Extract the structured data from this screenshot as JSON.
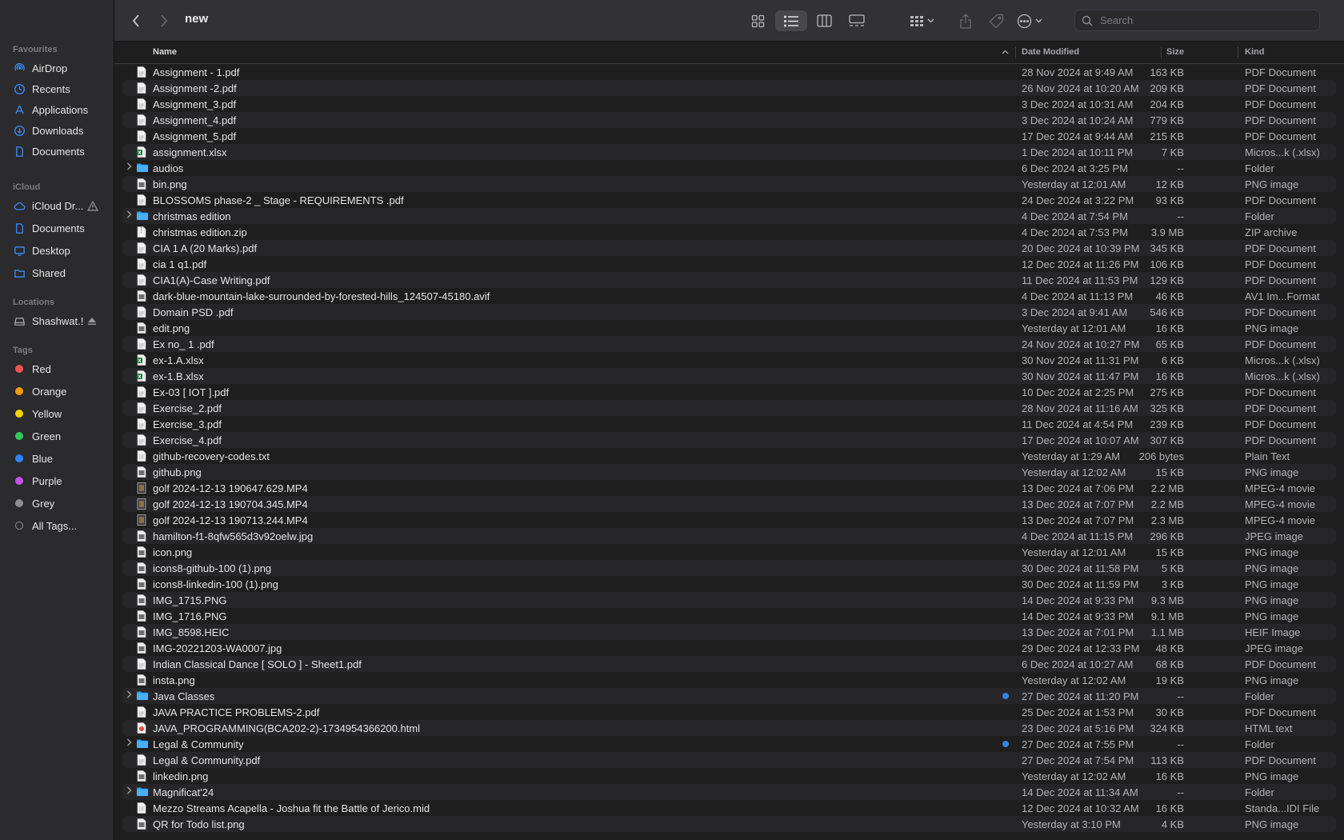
{
  "window": {
    "title": "new"
  },
  "search": {
    "placeholder": "Search"
  },
  "sidebar": {
    "favourites_label": "Favourites",
    "favourites": [
      {
        "label": "AirDrop",
        "icon": "airdrop-icon"
      },
      {
        "label": "Recents",
        "icon": "clock-icon"
      },
      {
        "label": "Applications",
        "icon": "applications-icon"
      },
      {
        "label": "Downloads",
        "icon": "download-icon"
      },
      {
        "label": "Documents",
        "icon": "document-icon"
      }
    ],
    "icloud_label": "iCloud",
    "icloud": [
      {
        "label": "iCloud Dr...",
        "icon": "cloud-icon"
      },
      {
        "label": "Documents",
        "icon": "document-icon"
      },
      {
        "label": "Desktop",
        "icon": "desktop-icon"
      },
      {
        "label": "Shared",
        "icon": "shared-folder-icon"
      }
    ],
    "locations_label": "Locations",
    "locations": [
      {
        "label": "Shashwat.!",
        "icon": "disk-icon"
      }
    ],
    "tags_label": "Tags",
    "tags": [
      {
        "label": "Red",
        "color": "#ef5350"
      },
      {
        "label": "Orange",
        "color": "#f39c12"
      },
      {
        "label": "Yellow",
        "color": "#f5d10c"
      },
      {
        "label": "Green",
        "color": "#34c759"
      },
      {
        "label": "Blue",
        "color": "#2f84f4"
      },
      {
        "label": "Purple",
        "color": "#c653e6"
      },
      {
        "label": "Grey",
        "color": "#8e8e93"
      },
      {
        "label": "All Tags...",
        "color": ""
      }
    ]
  },
  "columns": {
    "name": "Name",
    "date": "Date Modified",
    "size": "Size",
    "kind": "Kind"
  },
  "files": [
    {
      "name": "Assignment - 1.pdf",
      "date": "28 Nov 2024 at 9:49 AM",
      "size": "163 KB",
      "kind": "PDF Document",
      "icon": "pdf"
    },
    {
      "name": "Assignment -2.pdf",
      "date": "26 Nov 2024 at 10:20 AM",
      "size": "209 KB",
      "kind": "PDF Document",
      "icon": "pdf"
    },
    {
      "name": "Assignment_3.pdf",
      "date": "3 Dec 2024 at 10:31 AM",
      "size": "204 KB",
      "kind": "PDF Document",
      "icon": "pdf"
    },
    {
      "name": "Assignment_4.pdf",
      "date": "3 Dec 2024 at 10:24 AM",
      "size": "779 KB",
      "kind": "PDF Document",
      "icon": "pdf"
    },
    {
      "name": "Assignment_5.pdf",
      "date": "17 Dec 2024 at 9:44 AM",
      "size": "215 KB",
      "kind": "PDF Document",
      "icon": "pdf"
    },
    {
      "name": "assignment.xlsx",
      "date": "1 Dec 2024 at 10:11 PM",
      "size": "7 KB",
      "kind": "Micros...k (.xlsx)",
      "icon": "xlsx"
    },
    {
      "name": "audios",
      "date": "6 Dec 2024 at 3:25 PM",
      "size": "--",
      "kind": "Folder",
      "icon": "folder"
    },
    {
      "name": "bin.png",
      "date": "Yesterday at 12:01 AM",
      "size": "12 KB",
      "kind": "PNG image",
      "icon": "image"
    },
    {
      "name": "BLOSSOMS phase-2 _ Stage - REQUIREMENTS .pdf",
      "date": "24 Dec 2024 at 3:22 PM",
      "size": "93 KB",
      "kind": "PDF Document",
      "icon": "pdf"
    },
    {
      "name": "christmas edition",
      "date": "4 Dec 2024 at 7:54 PM",
      "size": "--",
      "kind": "Folder",
      "icon": "folder"
    },
    {
      "name": "christmas edition.zip",
      "date": "4 Dec 2024 at 7:53 PM",
      "size": "3.9 MB",
      "kind": "ZIP archive",
      "icon": "zip"
    },
    {
      "name": "CIA 1 A (20 Marks).pdf",
      "date": "20 Dec 2024 at 10:39 PM",
      "size": "345 KB",
      "kind": "PDF Document",
      "icon": "pdf"
    },
    {
      "name": "cia 1 q1.pdf",
      "date": "12 Dec 2024 at 11:26 PM",
      "size": "106 KB",
      "kind": "PDF Document",
      "icon": "pdf"
    },
    {
      "name": "CIA1(A)-Case Writing.pdf",
      "date": "11 Dec 2024 at 11:53 PM",
      "size": "129 KB",
      "kind": "PDF Document",
      "icon": "pdf"
    },
    {
      "name": "dark-blue-mountain-lake-surrounded-by-forested-hills_124507-45180.avif",
      "date": "4 Dec 2024 at 11:13 PM",
      "size": "46 KB",
      "kind": "AV1 Im...Format",
      "icon": "image"
    },
    {
      "name": "Domain PSD .pdf",
      "date": "3 Dec 2024 at 9:41 AM",
      "size": "546 KB",
      "kind": "PDF Document",
      "icon": "pdf"
    },
    {
      "name": "edit.png",
      "date": "Yesterday at 12:01 AM",
      "size": "16 KB",
      "kind": "PNG image",
      "icon": "image"
    },
    {
      "name": "Ex no_ 1 .pdf",
      "date": "24 Nov 2024 at 10:27 PM",
      "size": "65 KB",
      "kind": "PDF Document",
      "icon": "pdf"
    },
    {
      "name": "ex-1.A.xlsx",
      "date": "30 Nov 2024 at 11:31 PM",
      "size": "6 KB",
      "kind": "Micros...k (.xlsx)",
      "icon": "xlsx"
    },
    {
      "name": "ex-1.B.xlsx",
      "date": "30 Nov 2024 at 11:47 PM",
      "size": "16 KB",
      "kind": "Micros...k (.xlsx)",
      "icon": "xlsx"
    },
    {
      "name": "Ex-03 [ IOT ].pdf",
      "date": "10 Dec 2024 at 2:25 PM",
      "size": "275 KB",
      "kind": "PDF Document",
      "icon": "pdf"
    },
    {
      "name": "Exercise_2.pdf",
      "date": "28 Nov 2024 at 11:16 AM",
      "size": "325 KB",
      "kind": "PDF Document",
      "icon": "pdf"
    },
    {
      "name": "Exercise_3.pdf",
      "date": "11 Dec 2024 at 4:54 PM",
      "size": "239 KB",
      "kind": "PDF Document",
      "icon": "pdf"
    },
    {
      "name": "Exercise_4.pdf",
      "date": "17 Dec 2024 at 10:07 AM",
      "size": "307 KB",
      "kind": "PDF Document",
      "icon": "pdf"
    },
    {
      "name": "github-recovery-codes.txt",
      "date": "Yesterday at 1:29 AM",
      "size": "206 bytes",
      "kind": "Plain Text",
      "icon": "text"
    },
    {
      "name": "github.png",
      "date": "Yesterday at 12:02 AM",
      "size": "15 KB",
      "kind": "PNG image",
      "icon": "image"
    },
    {
      "name": "golf 2024-12-13 190647.629.MP4",
      "date": "13 Dec 2024 at 7:06 PM",
      "size": "2.2 MB",
      "kind": "MPEG-4 movie",
      "icon": "movie"
    },
    {
      "name": "golf 2024-12-13 190704.345.MP4",
      "date": "13 Dec 2024 at 7:07 PM",
      "size": "2.2 MB",
      "kind": "MPEG-4 movie",
      "icon": "movie"
    },
    {
      "name": "golf 2024-12-13 190713.244.MP4",
      "date": "13 Dec 2024 at 7:07 PM",
      "size": "2.3 MB",
      "kind": "MPEG-4 movie",
      "icon": "movie"
    },
    {
      "name": "hamilton-f1-8qfw565d3v92oelw.jpg",
      "date": "4 Dec 2024 at 11:15 PM",
      "size": "296 KB",
      "kind": "JPEG image",
      "icon": "image"
    },
    {
      "name": "icon.png",
      "date": "Yesterday at 12:01 AM",
      "size": "15 KB",
      "kind": "PNG image",
      "icon": "image"
    },
    {
      "name": "icons8-github-100 (1).png",
      "date": "30 Dec 2024 at 11:58 PM",
      "size": "5 KB",
      "kind": "PNG image",
      "icon": "image"
    },
    {
      "name": "icons8-linkedin-100 (1).png",
      "date": "30 Dec 2024 at 11:59 PM",
      "size": "3 KB",
      "kind": "PNG image",
      "icon": "image"
    },
    {
      "name": "IMG_1715.PNG",
      "date": "14 Dec 2024 at 9:33 PM",
      "size": "9.3 MB",
      "kind": "PNG image",
      "icon": "image"
    },
    {
      "name": "IMG_1716.PNG",
      "date": "14 Dec 2024 at 9:33 PM",
      "size": "9.1 MB",
      "kind": "PNG image",
      "icon": "image"
    },
    {
      "name": "IMG_8598.HEIC",
      "date": "13 Dec 2024 at 7:01 PM",
      "size": "1.1 MB",
      "kind": "HEIF Image",
      "icon": "image"
    },
    {
      "name": "IMG-20221203-WA0007.jpg",
      "date": "29 Dec 2024 at 12:33 PM",
      "size": "48 KB",
      "kind": "JPEG image",
      "icon": "image"
    },
    {
      "name": "Indian Classical Dance [ SOLO ]  - Sheet1.pdf",
      "date": "6 Dec 2024 at 10:27 AM",
      "size": "68 KB",
      "kind": "PDF Document",
      "icon": "pdf"
    },
    {
      "name": "insta.png",
      "date": "Yesterday at 12:02 AM",
      "size": "19 KB",
      "kind": "PNG image",
      "icon": "image"
    },
    {
      "name": "Java Classes",
      "date": "27 Dec 2024 at 11:20 PM",
      "size": "--",
      "kind": "Folder",
      "icon": "folder",
      "tag": "#2f84f4"
    },
    {
      "name": "JAVA PRACTICE PROBLEMS-2.pdf",
      "date": "25 Dec 2024 at 1:53 PM",
      "size": "30 KB",
      "kind": "PDF Document",
      "icon": "pdf"
    },
    {
      "name": "JAVA_PROGRAMMING(BCA202-2)-1734954366200.html",
      "date": "23 Dec 2024 at 5:16 PM",
      "size": "324 KB",
      "kind": "HTML text",
      "icon": "html"
    },
    {
      "name": "Legal & Community",
      "date": "27 Dec 2024 at 7:55 PM",
      "size": "--",
      "kind": "Folder",
      "icon": "folder",
      "tag": "#2f84f4"
    },
    {
      "name": "Legal & Community.pdf",
      "date": "27 Dec 2024 at 7:54 PM",
      "size": "113 KB",
      "kind": "PDF Document",
      "icon": "pdf"
    },
    {
      "name": "linkedin.png",
      "date": "Yesterday at 12:02 AM",
      "size": "16 KB",
      "kind": "PNG image",
      "icon": "image"
    },
    {
      "name": "Magnificat'24",
      "date": "14 Dec 2024 at 11:34 AM",
      "size": "--",
      "kind": "Folder",
      "icon": "folder"
    },
    {
      "name": "Mezzo Streams Acapella - Joshua fit the Battle of Jerico.mid",
      "date": "12 Dec 2024 at 10:32 AM",
      "size": "16 KB",
      "kind": "Standa...IDI File",
      "icon": "text"
    },
    {
      "name": "QR for Todo list.png",
      "date": "Yesterday at 3:10 PM",
      "size": "4 KB",
      "kind": "PNG image",
      "icon": "image"
    }
  ]
}
